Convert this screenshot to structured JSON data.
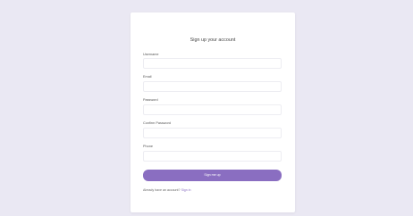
{
  "form": {
    "title": "Sign up your account",
    "fields": [
      {
        "label": "Username",
        "value": "",
        "placeholder": ""
      },
      {
        "label": "Email",
        "value": "",
        "placeholder": ""
      },
      {
        "label": "Password",
        "value": "",
        "placeholder": ""
      },
      {
        "label": "Confirm Password",
        "value": "",
        "placeholder": ""
      },
      {
        "label": "Phone",
        "value": "",
        "placeholder": ""
      }
    ],
    "submit_label": "Sign me up",
    "footer_text": "Already have an account?",
    "footer_link": "Sign in"
  },
  "colors": {
    "background": "#eae8f3",
    "card": "#ffffff",
    "accent": "#8a6ec1"
  }
}
